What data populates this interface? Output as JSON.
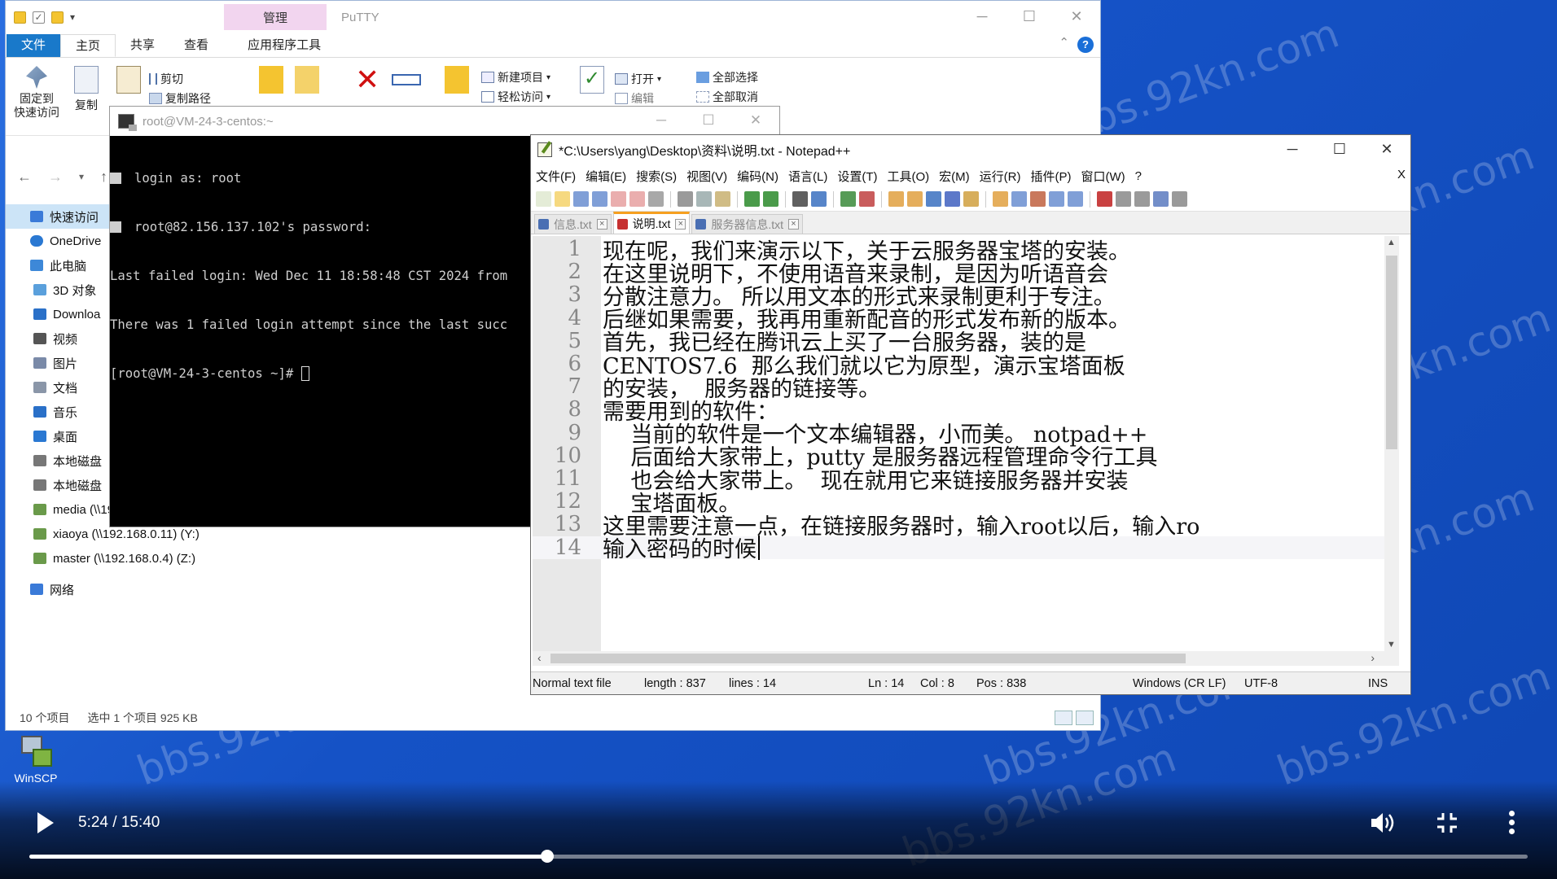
{
  "explorer": {
    "manage_tab": "管理",
    "app_name": "PuTTY",
    "tabs": [
      "文件",
      "主页",
      "共享",
      "查看",
      "应用程序工具"
    ],
    "ribbon": {
      "pin": "固定到\n快速访问",
      "copy": "复制",
      "paste": "粘贴",
      "cut": "剪切",
      "copy_path": "复制路径",
      "move_to": "移动到",
      "copy_to": "复制到",
      "delete": "删除",
      "rename": "重命名",
      "new_folder": "新建",
      "new_item": "新建项目",
      "easy_access": "轻松访问",
      "properties": "属性",
      "open": "打开",
      "edit": "编辑",
      "select_all": "全部选择",
      "select_none": "全部取消"
    },
    "nav": [
      {
        "label": "快速访问",
        "icon": "star-icon",
        "indent": 1
      },
      {
        "label": "OneDrive",
        "icon": "cloud-icon",
        "indent": 1
      },
      {
        "label": "此电脑",
        "icon": "computer-icon",
        "indent": 1
      },
      {
        "label": "3D 对象",
        "icon": "cube-icon",
        "indent": 2
      },
      {
        "label": "Downloa",
        "icon": "download-icon",
        "indent": 2
      },
      {
        "label": "视频",
        "icon": "video-icon",
        "indent": 2
      },
      {
        "label": "图片",
        "icon": "picture-icon",
        "indent": 2
      },
      {
        "label": "文档",
        "icon": "document-icon",
        "indent": 2
      },
      {
        "label": "音乐",
        "icon": "music-icon",
        "indent": 2
      },
      {
        "label": "桌面",
        "icon": "desktop-icon",
        "indent": 2
      },
      {
        "label": "本地磁盘",
        "icon": "disk-icon",
        "indent": 2
      },
      {
        "label": "本地磁盘",
        "icon": "disk-icon",
        "indent": 2
      },
      {
        "label": "media (\\\\192.168.0.4) (U:)",
        "icon": "network-drive-icon",
        "indent": 2
      },
      {
        "label": "xiaoya (\\\\192.168.0.11) (Y:)",
        "icon": "network-drive-icon",
        "indent": 2
      },
      {
        "label": "master (\\\\192.168.0.4) (Z:)",
        "icon": "network-drive-icon",
        "indent": 2
      },
      {
        "label": "网络",
        "icon": "network-icon",
        "indent": 1
      }
    ],
    "status": {
      "count": "10 个项目",
      "selected": "选中 1 个项目  925 KB"
    }
  },
  "desktop": {
    "winscp_label": "WinSCP",
    "watermark": "bbs.92kn.com"
  },
  "putty": {
    "title": "root@VM-24-3-centos:~",
    "lines": [
      "login as: root",
      "root@82.156.137.102's password:",
      "Last failed login: Wed Dec 11 18:58:48 CST 2024 from",
      "There was 1 failed login attempt since the last succ",
      "[root@VM-24-3-centos ~]# "
    ]
  },
  "npp": {
    "title": "*C:\\Users\\yang\\Desktop\\资料\\说明.txt - Notepad++",
    "menu": [
      "文件(F)",
      "编辑(E)",
      "搜索(S)",
      "视图(V)",
      "编码(N)",
      "语言(L)",
      "设置(T)",
      "工具(O)",
      "宏(M)",
      "运行(R)",
      "插件(P)",
      "窗口(W)",
      "?"
    ],
    "close_doc": "X",
    "tabs": [
      {
        "label": "信息.txt",
        "active": false
      },
      {
        "label": "说明.txt",
        "active": true
      },
      {
        "label": "服务器信息.txt",
        "active": false
      }
    ],
    "lines": [
      "现在呢，我们来演示以下，关于云服务器宝塔的安装。",
      "在这里说明下，不使用语音来录制，是因为听语音会",
      "分散注意力。 所以用文本的形式来录制更利于专注。",
      "后继如果需要，我再用重新配音的形式发布新的版本。",
      "首先，我已经在腾讯云上买了一台服务器，装的是",
      "CENTOS7.6  那么我们就以它为原型，演示宝塔面板",
      "的安装，  服务器的链接等。",
      "需要用到的软件：",
      "    当前的软件是一个文本编辑器，小而美。 notpad++",
      "    后面给大家带上，putty 是服务器远程管理命令行工具",
      "    也会给大家带上。  现在就用它来链接服务器并安装",
      "    宝塔面板。",
      "这里需要注意一点，在链接服务器时，输入root以后，输入ro",
      "输入密码的时候"
    ],
    "current_line": 14,
    "status": {
      "type": "Normal text file",
      "length": "length : 837",
      "lines": "lines : 14",
      "ln": "Ln : 14",
      "col": "Col : 8",
      "pos": "Pos : 838",
      "eol": "Windows (CR LF)",
      "enc": "UTF-8",
      "mode": "INS"
    }
  },
  "player": {
    "time": "5:24 / 15:40",
    "progress": 0.3457,
    "accent": "#ffffff"
  }
}
